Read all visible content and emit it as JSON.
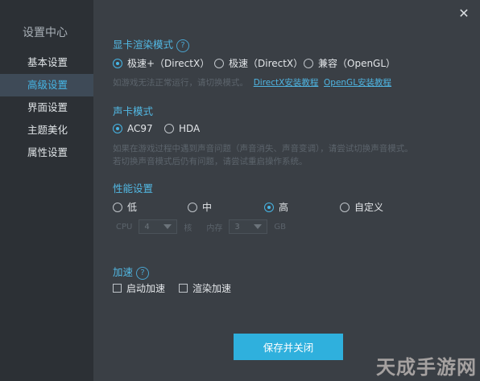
{
  "window": {
    "close_icon": "close-icon"
  },
  "sidebar": {
    "title": "设置中心",
    "items": [
      {
        "label": "基本设置",
        "active": false
      },
      {
        "label": "高级设置",
        "active": true
      },
      {
        "label": "界面设置",
        "active": false
      },
      {
        "label": "主题美化",
        "active": false
      },
      {
        "label": "属性设置",
        "active": false
      }
    ]
  },
  "render": {
    "title": "显卡渲染模式",
    "options": [
      "极速+（DirectX）",
      "极速（DirectX）",
      "兼容（OpenGL）"
    ],
    "selected_index": 0,
    "hint": "如游戏无法正常运行，请切换模式。",
    "links": [
      "DirectX安装教程",
      "OpenGL安装教程"
    ]
  },
  "sound": {
    "title": "声卡模式",
    "options": [
      "AC97",
      "HDA"
    ],
    "selected_index": 0,
    "hint_line1": "如果在游戏过程中遇到声音问题（声音消失、声音变调），请尝试切换声音模式。",
    "hint_line2": "若切换声音模式后仍有问题，请尝试重启操作系统。"
  },
  "perf": {
    "title": "性能设置",
    "options": [
      "低",
      "中",
      "高",
      "自定义"
    ],
    "selected_index": 2,
    "cpu_label": "CPU",
    "cpu_value": "4",
    "cpu_unit": "核",
    "mem_label": "内存",
    "mem_value": "3",
    "mem_unit": "GB"
  },
  "accel": {
    "title": "加速",
    "options": [
      "启动加速",
      "渲染加速"
    ]
  },
  "footer": {
    "save_label": "保存并关闭"
  },
  "watermark": "天成手游网",
  "colors": {
    "accent": "#46b6e6",
    "button": "#2fb0dd"
  }
}
